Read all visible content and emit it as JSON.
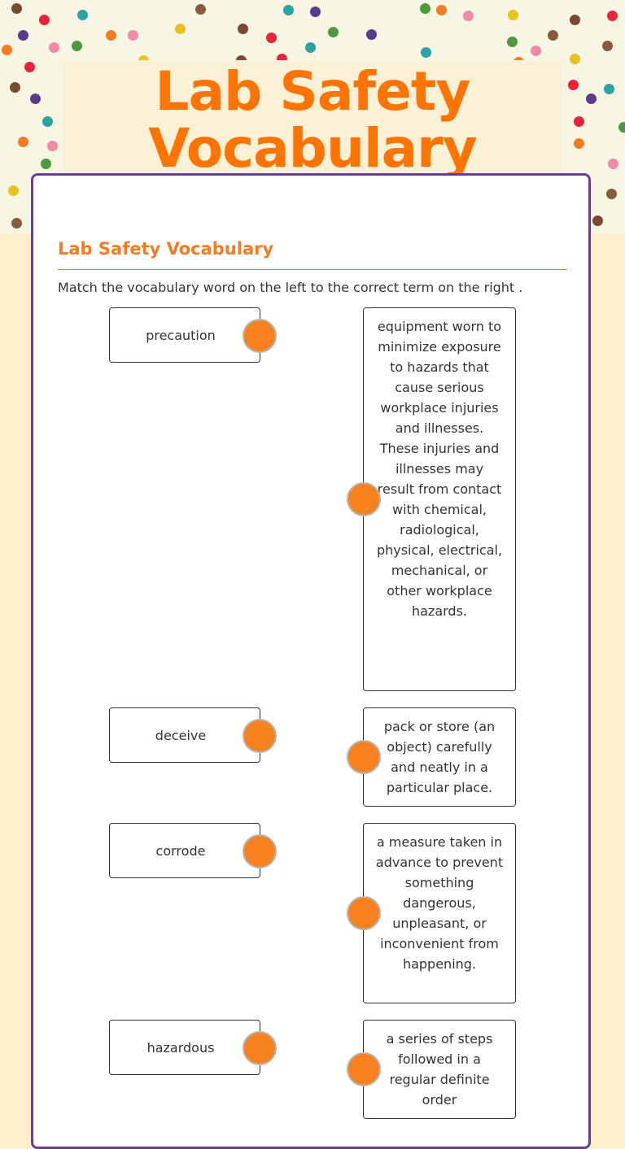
{
  "header": {
    "title": "Lab Safety Vocabulary"
  },
  "worksheet": {
    "section_title": "Lab Safety Vocabulary",
    "instructions": "Match the vocabulary word on the left to the correct term on the right .",
    "words": [
      {
        "label": "precaution"
      },
      {
        "label": "deceive"
      },
      {
        "label": "corrode"
      },
      {
        "label": "hazardous"
      }
    ],
    "definitions": [
      {
        "text": "equipment worn to minimize exposure to hazards that cause serious workplace injuries and illnesses. These injuries and illnesses may result from contact with chemical, radiological, physical, electrical, mechanical, or other workplace hazards."
      },
      {
        "text": "pack or store (an object) carefully and neatly in a particular place."
      },
      {
        "text": "a measure taken in advance to prevent something dangerous, unpleasant, or inconvenient from happening."
      },
      {
        "text": "a series of steps followed in a regular definite order"
      }
    ]
  },
  "colors": {
    "accent": "#f47b20",
    "title": "#ff7300",
    "card_border": "#6b3c94",
    "handle": "#f7811e"
  }
}
